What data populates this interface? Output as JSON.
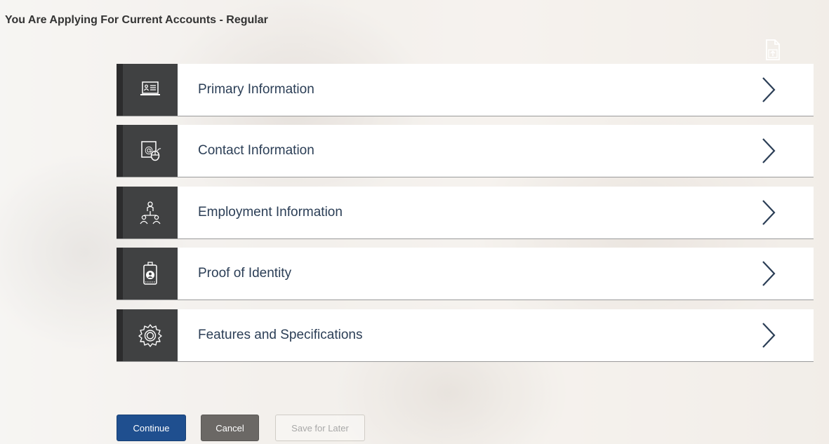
{
  "page": {
    "title": "You Are Applying For Current Accounts - Regular"
  },
  "toolbar": {
    "upload_icon": "document-upload-icon"
  },
  "sections": [
    {
      "label": "Primary Information",
      "icon": "id-card-monitor-icon"
    },
    {
      "label": "Contact Information",
      "icon": "email-contact-icon"
    },
    {
      "label": "Employment Information",
      "icon": "organization-people-icon"
    },
    {
      "label": "Proof of Identity",
      "icon": "id-badge-icon"
    },
    {
      "label": "Features and Specifications",
      "icon": "gear-icon"
    }
  ],
  "actions": {
    "continue_label": "Continue",
    "cancel_label": "Cancel",
    "save_later_label": "Save for Later"
  },
  "colors": {
    "primary_button": "#1f4f8f",
    "secondary_button": "#6b6865",
    "icon_panel": "#404142",
    "section_text": "#2b3e56"
  }
}
